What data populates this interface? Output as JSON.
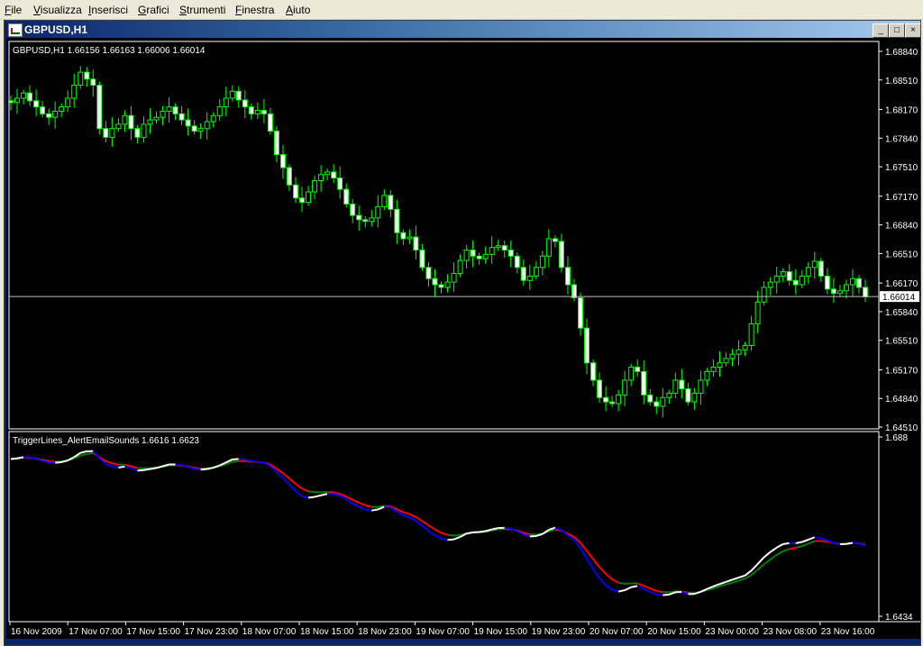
{
  "menu": [
    {
      "label": "File",
      "u": "F"
    },
    {
      "label": "Visualizza",
      "u": "V"
    },
    {
      "label": "Inserisci",
      "u": "I"
    },
    {
      "label": "Grafici",
      "u": "G"
    },
    {
      "label": "Strumenti",
      "u": "S"
    },
    {
      "label": "Finestra",
      "u": "F"
    },
    {
      "label": "Aiuto",
      "u": "A"
    }
  ],
  "window": {
    "title": "GBPUSD,H1",
    "min_glyph": "_",
    "max_glyph": "□",
    "close_glyph": "×"
  },
  "price_panel": {
    "info": "GBPUSD,H1  1.66156  1.66163  1.66006  1.66014",
    "price_ticks": [
      "1.68840",
      "1.68510",
      "1.68170",
      "1.67840",
      "1.67510",
      "1.67170",
      "1.66840",
      "1.66510",
      "1.66170",
      "1.65840",
      "1.65510",
      "1.65170",
      "1.64840",
      "1.64510"
    ],
    "current_price": "1.66014"
  },
  "indicator_panel": {
    "info": "TriggerLines_AlertEmailSounds  1.6616  1.6623",
    "ticks": [
      "1.688",
      "1.6434"
    ]
  },
  "time_ticks": [
    "16 Nov 2009",
    "17 Nov 07:00",
    "17 Nov 15:00",
    "17 Nov 23:00",
    "18 Nov 07:00",
    "18 Nov 15:00",
    "18 Nov 23:00",
    "19 Nov 07:00",
    "19 Nov 15:00",
    "19 Nov 23:00",
    "20 Nov 07:00",
    "20 Nov 15:00",
    "23 Nov 00:00",
    "23 Nov 08:00",
    "23 Nov 16:00"
  ],
  "colors": {
    "background": "#000000",
    "axis": "#ffffff",
    "bull_candle": "#000000",
    "bear_candle": "#ffffff",
    "wick": "#00ff00",
    "current_line": "#c0c0c0",
    "trigger_up": "#0000ff",
    "trigger_down": "#ff0000",
    "signal_up": "#ffffff",
    "signal_down": "#008000"
  },
  "chart_data": {
    "type": "candlestick",
    "symbol": "GBPUSD",
    "timeframe": "H1",
    "ylim": [
      1.6451,
      1.6884
    ],
    "closes": [
      1.6825,
      1.683,
      1.6836,
      1.6827,
      1.682,
      1.6812,
      1.6808,
      1.6815,
      1.682,
      1.683,
      1.6845,
      1.686,
      1.6852,
      1.6845,
      1.6795,
      1.6785,
      1.6795,
      1.68,
      1.681,
      1.6795,
      1.6785,
      1.68,
      1.6805,
      1.6808,
      1.6815,
      1.682,
      1.6812,
      1.6805,
      1.6798,
      1.6792,
      1.6795,
      1.6803,
      1.681,
      1.682,
      1.683,
      1.6838,
      1.6828,
      1.682,
      1.6812,
      1.6816,
      1.6812,
      1.6792,
      1.6765,
      1.675,
      1.673,
      1.6715,
      1.671,
      1.6722,
      1.6735,
      1.6742,
      1.6745,
      1.6738,
      1.6725,
      1.6708,
      1.6695,
      1.669,
      1.6688,
      1.6692,
      1.6705,
      1.6718,
      1.6702,
      1.6675,
      1.6668,
      1.667,
      1.6655,
      1.6635,
      1.6622,
      1.6615,
      1.6612,
      1.6618,
      1.6628,
      1.6643,
      1.6655,
      1.6648,
      1.6645,
      1.665,
      1.6658,
      1.666,
      1.6655,
      1.6648,
      1.6635,
      1.662,
      1.6625,
      1.6635,
      1.6648,
      1.6668,
      1.6665,
      1.6635,
      1.6615,
      1.66,
      1.6565,
      1.6525,
      1.6505,
      1.6485,
      1.648,
      1.6478,
      1.6488,
      1.6505,
      1.652,
      1.6515,
      1.6488,
      1.648,
      1.6475,
      1.6485,
      1.649,
      1.6505,
      1.6495,
      1.648,
      1.649,
      1.6505,
      1.6515,
      1.652,
      1.6525,
      1.653,
      1.6535,
      1.654,
      1.6545,
      1.657,
      1.6595,
      1.6612,
      1.6618,
      1.6625,
      1.663,
      1.662,
      1.6615,
      1.6625,
      1.6635,
      1.6642,
      1.6625,
      1.661,
      1.6605,
      1.6608,
      1.6615,
      1.6622,
      1.6612,
      1.6601
    ]
  }
}
